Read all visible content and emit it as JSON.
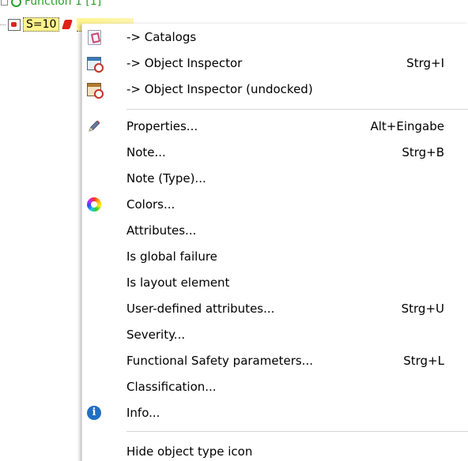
{
  "tree": {
    "row1_label": "Function 1 [1]",
    "row2_label": "S=10"
  },
  "menu": {
    "items": [
      {
        "label": "-> Catalogs",
        "shortcut": "",
        "icon": "catalogs-icon"
      },
      {
        "label": "-> Object Inspector",
        "shortcut": "Strg+I",
        "icon": "object-inspector-icon"
      },
      {
        "label": "-> Object Inspector (undocked)",
        "shortcut": "",
        "icon": "object-inspector-undocked-icon"
      },
      {
        "label": "Properties...",
        "shortcut": "Alt+Eingabe",
        "icon": "pencil-icon"
      },
      {
        "label": "Note...",
        "shortcut": "Strg+B",
        "icon": ""
      },
      {
        "label": "Note (Type)...",
        "shortcut": "",
        "icon": ""
      },
      {
        "label": "Colors...",
        "shortcut": "",
        "icon": "color-wheel-icon"
      },
      {
        "label": "Attributes...",
        "shortcut": "",
        "icon": ""
      },
      {
        "label": "Is global failure",
        "shortcut": "",
        "icon": ""
      },
      {
        "label": "Is layout element",
        "shortcut": "",
        "icon": ""
      },
      {
        "label": "User-defined attributes...",
        "shortcut": "Strg+U",
        "icon": ""
      },
      {
        "label": "Severity...",
        "shortcut": "",
        "icon": ""
      },
      {
        "label": "Functional Safety parameters...",
        "shortcut": "Strg+L",
        "icon": ""
      },
      {
        "label": "Classification...",
        "shortcut": "",
        "icon": ""
      },
      {
        "label": "Info...",
        "shortcut": "",
        "icon": "info-icon"
      },
      {
        "label": "Hide object type icon",
        "shortcut": "",
        "icon": ""
      }
    ]
  }
}
